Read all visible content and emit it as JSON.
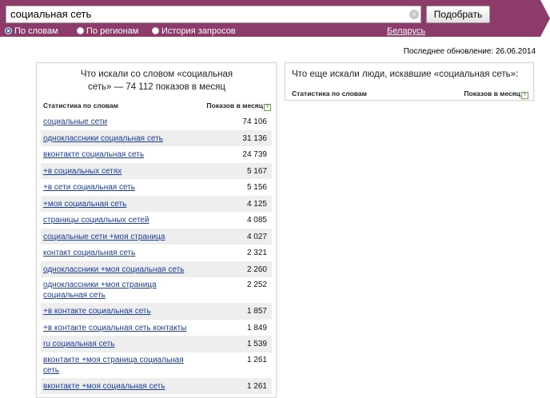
{
  "search": {
    "query": "социальная сеть",
    "submit_label": "Подобрать",
    "options": [
      {
        "label": "По словам",
        "selected": true
      },
      {
        "label": "По регионам",
        "selected": false
      },
      {
        "label": "История запросов",
        "selected": false
      }
    ],
    "region": "Беларусь"
  },
  "last_update": "Последнее обновление: 26.06.2014",
  "left_panel": {
    "title": "Что искали со словом «социальная сеть» — 74 112 показов в месяц",
    "col_words": "Статистика по словам",
    "col_shows": "Показов в месяц",
    "rows": [
      {
        "keyword": "социальные сети",
        "count": "74 106"
      },
      {
        "keyword": "одноклассники социальная сеть",
        "count": "31 136"
      },
      {
        "keyword": "вконтакте социальная сеть",
        "count": "24 739"
      },
      {
        "keyword": "+в социальных сетях",
        "count": "5 167"
      },
      {
        "keyword": "+в сети социальная сеть",
        "count": "5 156"
      },
      {
        "keyword": "+моя социальная сеть",
        "count": "4 125"
      },
      {
        "keyword": "страницы социальных сетей",
        "count": "4 085"
      },
      {
        "keyword": "социальные сети +моя страница",
        "count": "4 027"
      },
      {
        "keyword": "контакт социальная сеть",
        "count": "2 321"
      },
      {
        "keyword": "одноклассники +моя социальная сеть",
        "count": "2 260"
      },
      {
        "keyword": "одноклассники +моя страница социальная сеть",
        "count": "2 252"
      },
      {
        "keyword": "+в контакте социальная сеть",
        "count": "1 857"
      },
      {
        "keyword": "+в контакте социальная сеть контакты",
        "count": "1 849"
      },
      {
        "keyword": "ru социальная сеть",
        "count": "1 539"
      },
      {
        "keyword": "вконтакте +моя страница социальная сеть",
        "count": "1 261"
      },
      {
        "keyword": "вконтакте +моя социальная сеть",
        "count": "1 261"
      }
    ]
  },
  "right_panel": {
    "title": "Что еще искали люди, искавшие «социальная сеть»:",
    "col_words": "Статистика по словам",
    "col_shows": "Показов в месяц"
  },
  "colors": {
    "topbar": "#8c3b6b",
    "link": "#1a3c9a",
    "row_alt": "#eeeeee"
  },
  "icons": [
    "clear-icon",
    "radio-icon",
    "help-icon"
  ]
}
